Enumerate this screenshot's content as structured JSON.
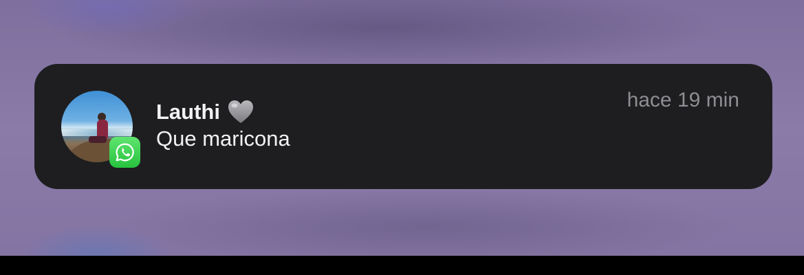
{
  "notification": {
    "app_icon": "whatsapp-icon",
    "sender": "Lauthi",
    "sender_emoji": "grey-heart-icon",
    "message": "Que maricona",
    "timestamp": "hace 19 min"
  },
  "colors": {
    "card_background": "#1e1e20",
    "primary_text": "#f2f2f4",
    "secondary_text": "#8e8e93",
    "whatsapp_green": "#27c23e"
  }
}
